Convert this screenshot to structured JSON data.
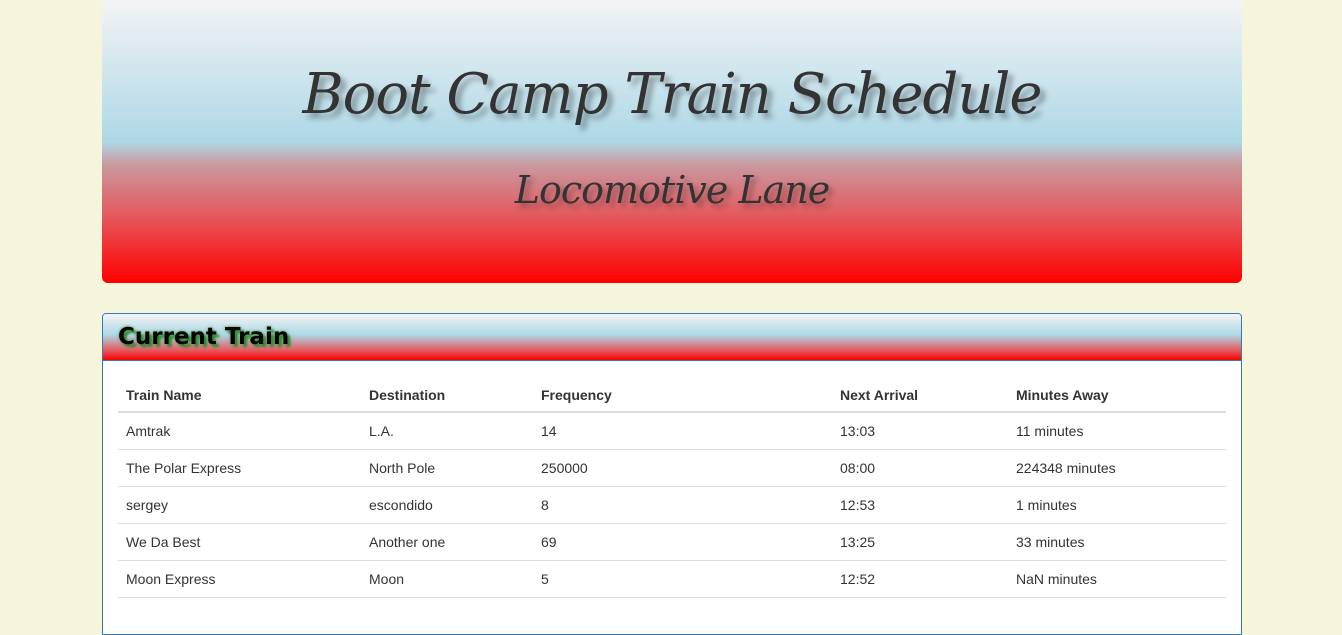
{
  "header": {
    "title": "Boot Camp Train Schedule",
    "subtitle": "Locomotive Lane"
  },
  "panel": {
    "title": "Current Train",
    "columns": [
      "Train Name",
      "Destination",
      "Frequency",
      "Next Arrival",
      "Minutes Away"
    ],
    "rows": [
      [
        "Amtrak",
        "L.A.",
        "14",
        "13:03",
        "11 minutes"
      ],
      [
        "The Polar Express",
        "North Pole",
        "250000",
        "08:00",
        "224348 minutes"
      ],
      [
        "sergey",
        "escondido",
        "8",
        "12:53",
        "1 minutes"
      ],
      [
        "We Da Best",
        "Another one",
        "69",
        "13:25",
        "33 minutes"
      ],
      [
        "Moon Express",
        "Moon",
        "5",
        "12:52",
        "NaN minutes"
      ]
    ]
  },
  "colors": {
    "background": "#f5f5dc",
    "gradient_top": "#add8e6",
    "gradient_bottom": "#ff0000",
    "panel_border": "#337ab7"
  }
}
